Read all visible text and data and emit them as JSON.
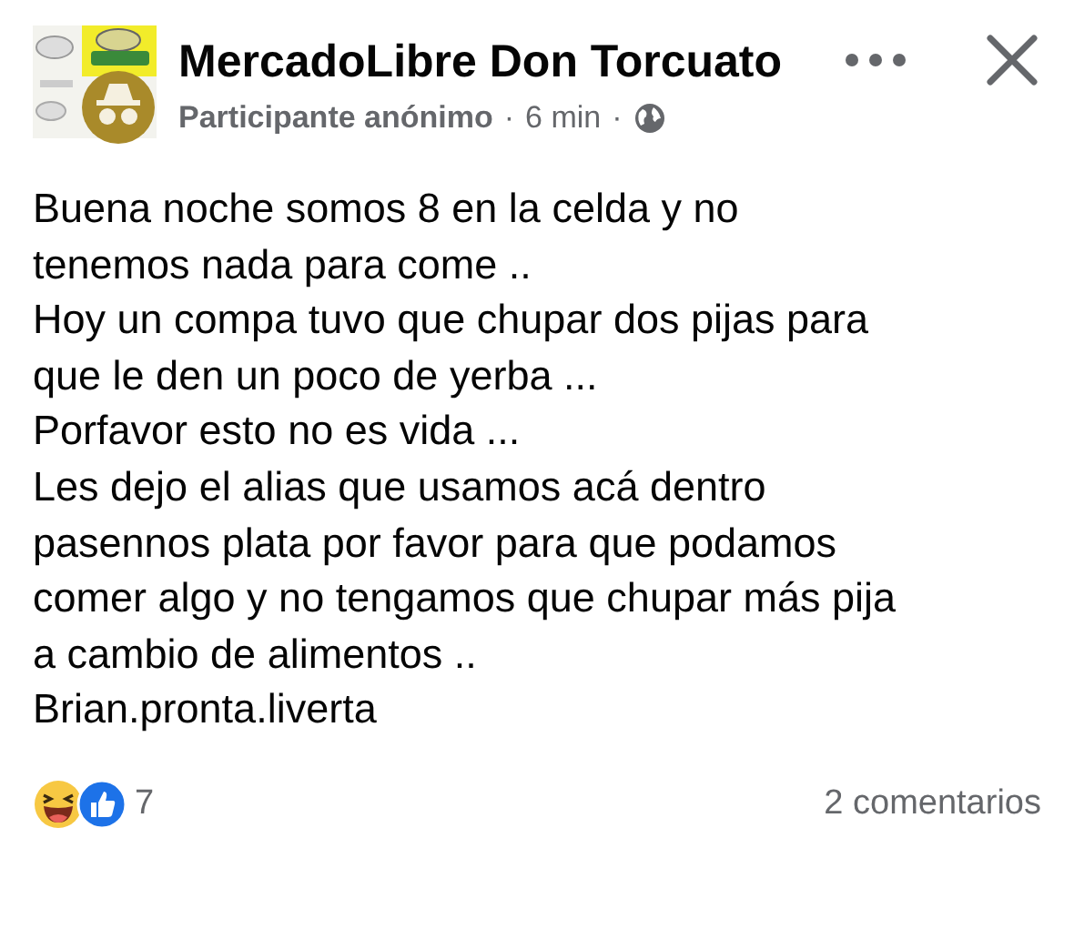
{
  "post": {
    "group_name": "MercadoLibre Don Torcuato",
    "author": "Participante anónimo",
    "separator_1": "·",
    "time": "6 min",
    "separator_2": "·",
    "body_lines": [
      "Buena noche somos 8 en la celda y no",
      "tenemos nada para come ..",
      "Hoy un compa tuvo que chupar dos pijas para",
      "que le den un poco de yerba ...",
      "Porfavor esto no es vida ...",
      "Les dejo el alias que usamos acá dentro",
      "pasennos plata por favor para que podamos",
      "comer algo y no tengamos que chupar más pija",
      "a cambio de alimentos ..",
      "Brian.pronta.liverta"
    ],
    "reaction_count": "7",
    "comments": "2 comentarios"
  }
}
